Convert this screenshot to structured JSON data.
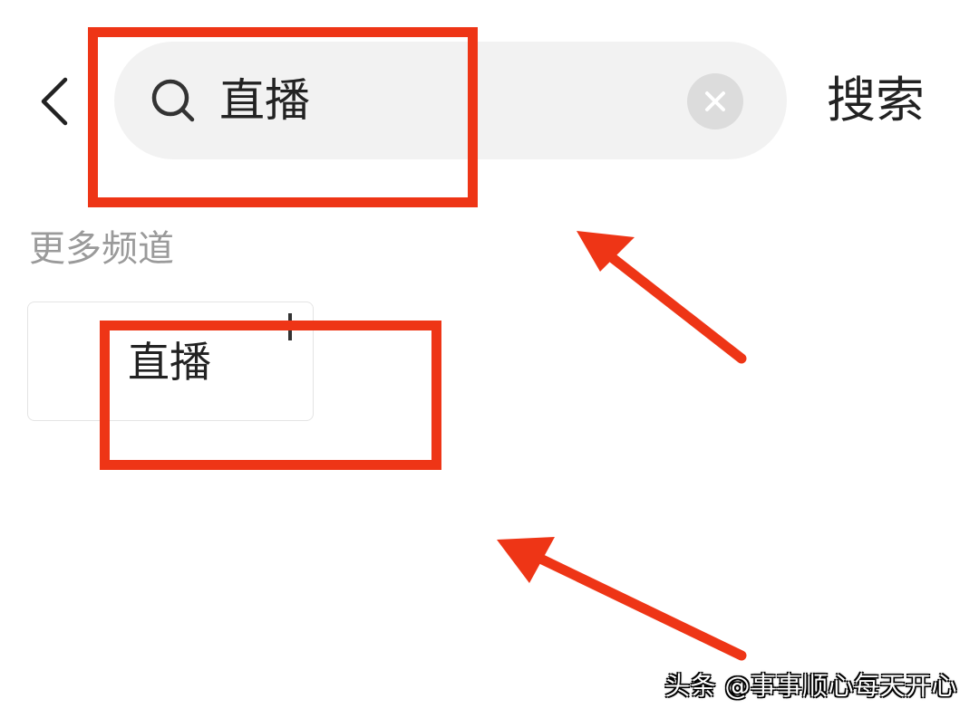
{
  "header": {
    "back_icon": "chevron-left-icon",
    "search": {
      "icon": "search-icon",
      "value": "直播",
      "clear_icon": "clear-icon"
    },
    "submit_label": "搜索"
  },
  "more_channels": {
    "title": "更多频道",
    "items": [
      {
        "label": "直播"
      }
    ]
  },
  "annotation": {
    "color": "#ee3516",
    "watermark": "头条 @事事顺心每天开心"
  }
}
